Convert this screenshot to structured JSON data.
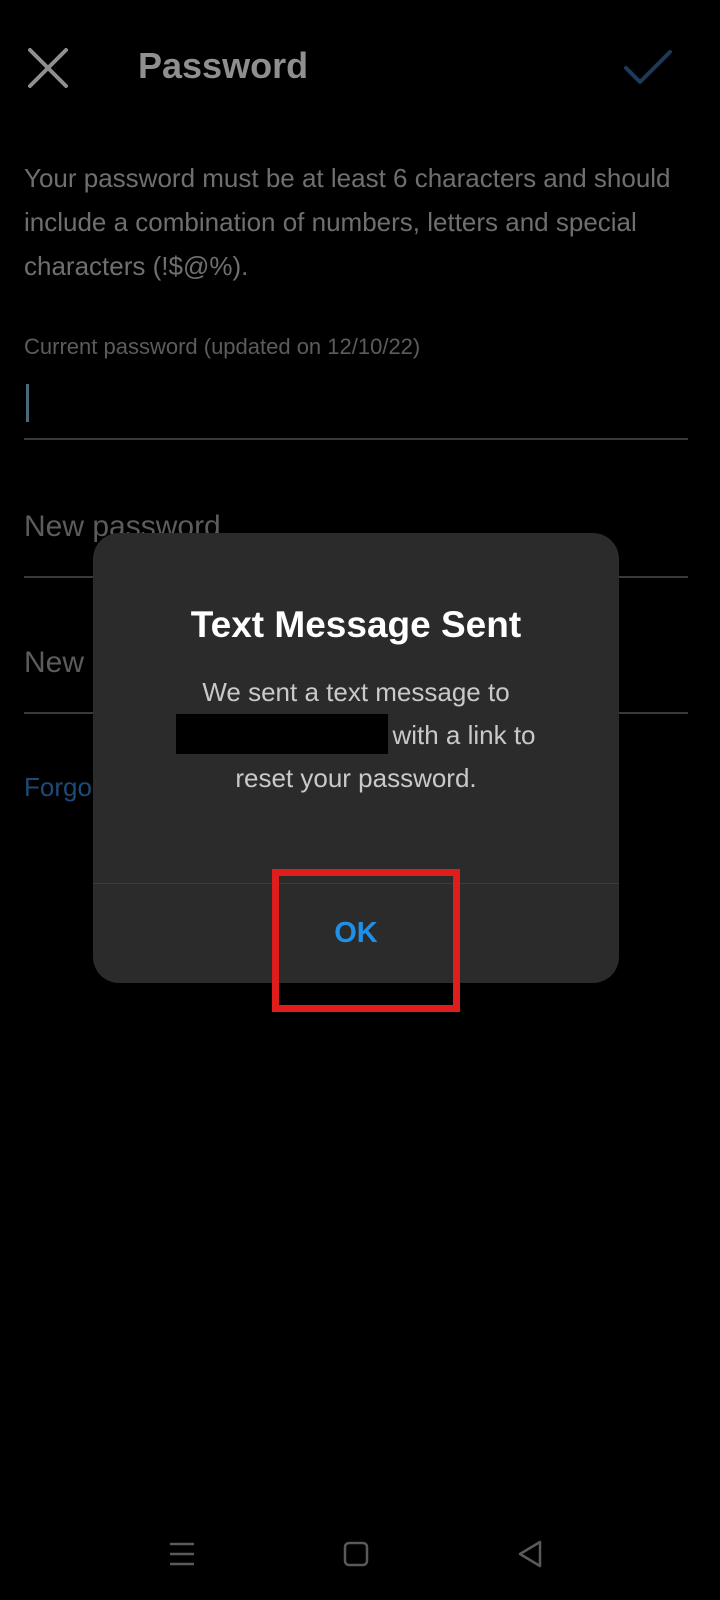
{
  "header": {
    "title": "Password",
    "close_icon": "close-icon",
    "confirm_icon": "checkmark-icon"
  },
  "intro_text": "Your password must be at least 6 characters and should include a combination of numbers, letters and special characters (!$@%).",
  "form": {
    "current_password_label": "Current password (updated on 12/10/22)",
    "current_password_value": "",
    "new_password_placeholder": "New password",
    "new_password_again_placeholder": "New",
    "forgot_link_visible": "Forgo"
  },
  "dialog": {
    "title": "Text Message Sent",
    "body_line1": "We sent a text message to",
    "body_line2": "with a link to",
    "body_line3": "reset your password.",
    "ok_label": "OK"
  },
  "colors": {
    "accent": "#1e90e8",
    "highlight": "#e01d1d",
    "dialog_bg": "#2b2b2b",
    "link": "#1d4a78"
  },
  "system_nav": {
    "menu_icon": "menu-icon",
    "home_icon": "home-square-icon",
    "back_icon": "back-triangle-icon"
  }
}
